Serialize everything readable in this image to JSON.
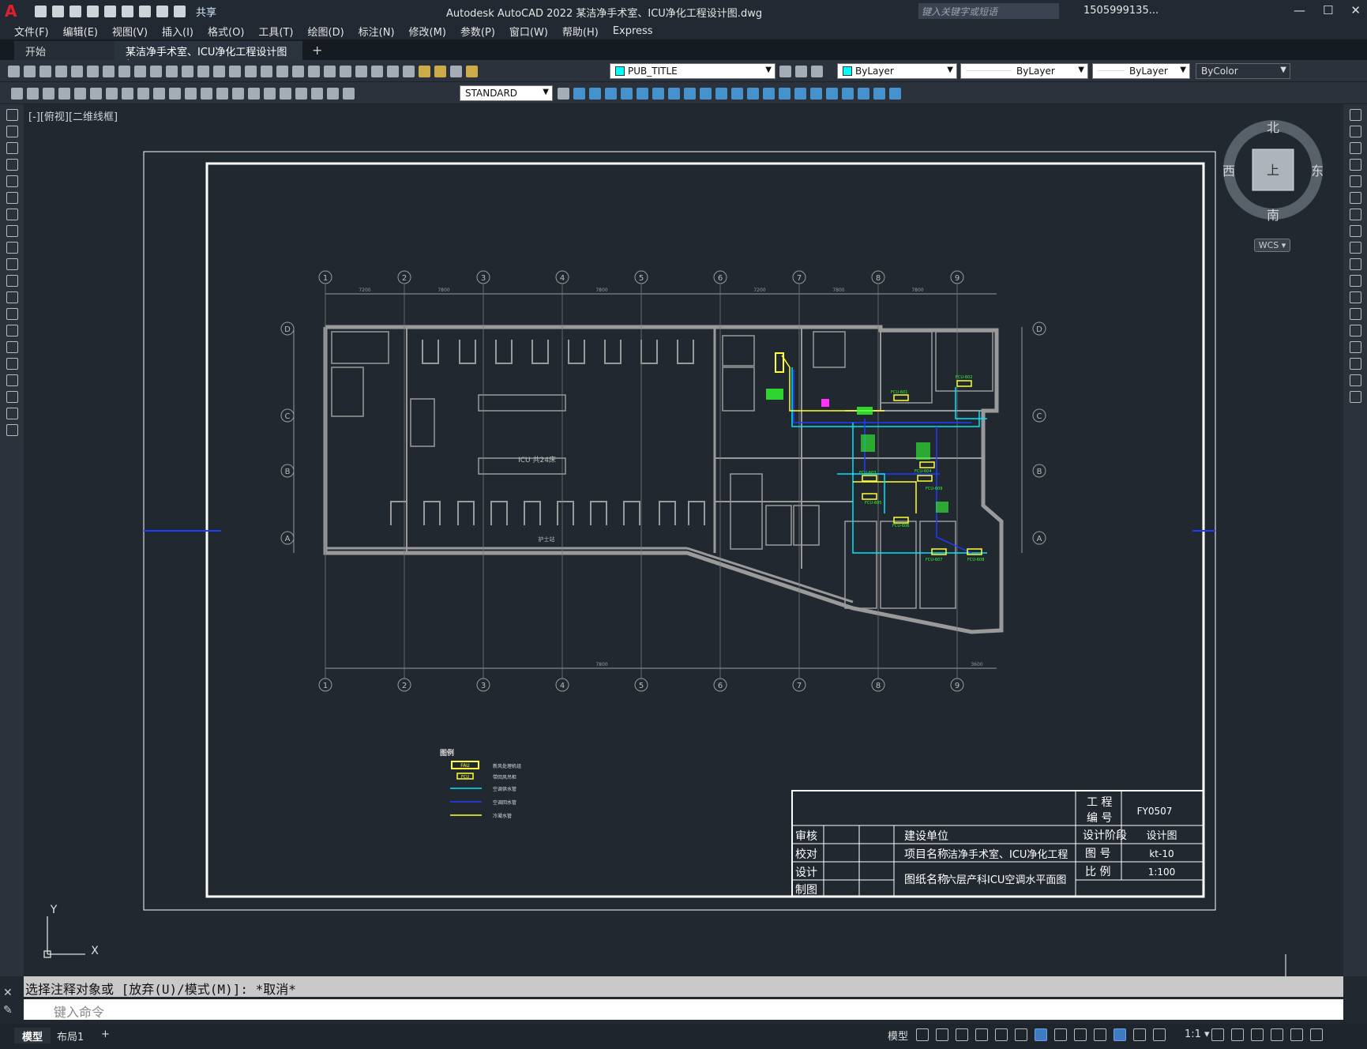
{
  "app": {
    "logo": "A",
    "title": "Autodesk AutoCAD 2022    某洁净手术室、ICU净化工程设计图.dwg",
    "share": "共享",
    "search_placeholder": "键入关键字或短语",
    "user": "1505999135...",
    "window_controls": [
      "—",
      "☐",
      "✕"
    ]
  },
  "menu": [
    "文件(F)",
    "编辑(E)",
    "视图(V)",
    "插入(I)",
    "格式(O)",
    "工具(T)",
    "绘图(D)",
    "标注(N)",
    "修改(M)",
    "参数(P)",
    "窗口(W)",
    "帮助(H)",
    "Express"
  ],
  "tabs": {
    "start": "开始",
    "doc": "某洁净手术室、ICU净化工程设计图*",
    "close": "✕",
    "add": "+"
  },
  "toolbar": {
    "layer": "PUB_TITLE",
    "color": "ByLayer",
    "linetype": "ByLayer",
    "lineweight": "ByLayer",
    "plotstyle": "ByColor",
    "textstyle": "STANDARD"
  },
  "viewport": {
    "label": "[-][俯视][二维线框]",
    "compass": {
      "n": "北",
      "s": "南",
      "e": "东",
      "w": "西",
      "top": "上"
    },
    "wcs": "WCS ▾",
    "ucs_x": "X",
    "ucs_y": "Y"
  },
  "drawing": {
    "grid_top": [
      "1",
      "2",
      "3",
      "4",
      "5",
      "6",
      "7",
      "8",
      "9"
    ],
    "grid_left": [
      "D",
      "C",
      "B",
      "A"
    ],
    "dims": [
      "7200",
      "7800",
      "7800",
      "7200",
      "7800",
      "7800",
      "7800",
      "3600"
    ],
    "rooms": {
      "icu": "ICU 共24床",
      "nurse": "护士站"
    },
    "equipment": [
      "FCU-601",
      "FCU-602",
      "FCU-603",
      "FCU-604",
      "FCU-605",
      "FCU-606",
      "FCU-607",
      "FCU-608",
      "FCU-609"
    ],
    "legend": {
      "title": "图例",
      "items": [
        "新风处理机组",
        "带回风吊柜",
        "空调供水管",
        "空调回水管",
        "冷凝水管"
      ],
      "fau_tag": "FAU",
      "fcu_tag": "FCU"
    }
  },
  "titleblock": {
    "project_no_label": "工 程\n编 号",
    "project_no": "FY0507",
    "stage_label": "设计阶段",
    "stage": "设计图",
    "drawing_no_label": "图 号",
    "drawing_no": "kt-10",
    "scale_label": "比 例",
    "scale": "1:100",
    "client_label": "建设单位",
    "project_label": "项目名称",
    "project_name": "洁净手术室、ICU净化工程",
    "drawing_label": "图纸名称",
    "drawing_name": "六层产科ICU空调水平面图",
    "roles": [
      "审核",
      "校对",
      "设计",
      "制图"
    ]
  },
  "command": {
    "history": "选择注释对象或 [放弃(U)/模式(M)]: *取消*",
    "placeholder": "键入命令"
  },
  "status": {
    "tabs": [
      "模型",
      "布局1",
      "+"
    ],
    "model": "模型",
    "scale": "1:1 ▾"
  },
  "colors": {
    "background": "#212830",
    "supply_pipe": "#00e5ff",
    "return_pipe": "#1e3cff",
    "condensate": "#ffff33",
    "equipment": "#33ff33"
  }
}
